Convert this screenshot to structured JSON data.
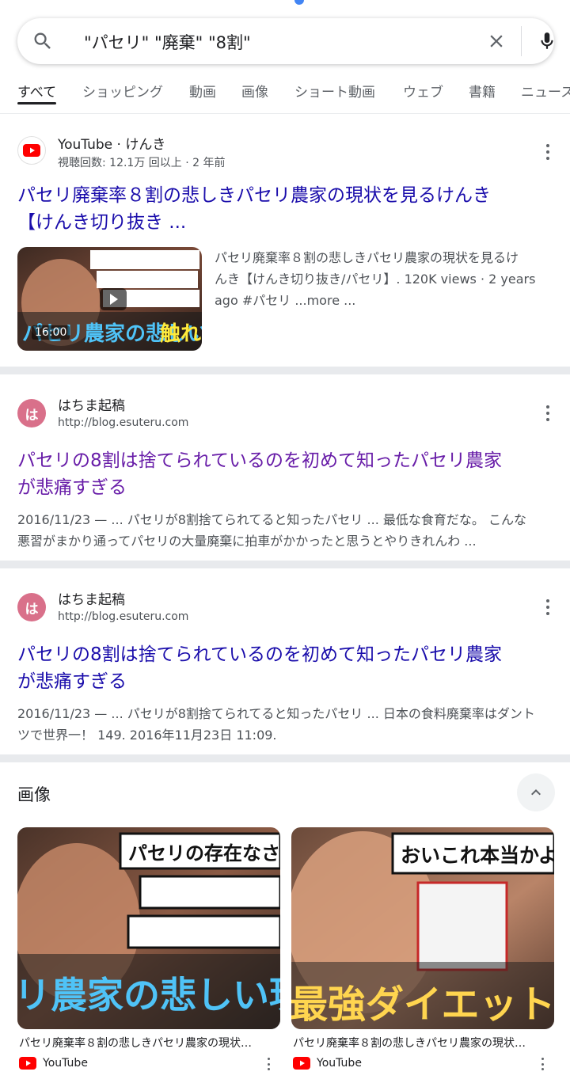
{
  "search": {
    "query": "\"パセリ\" \"廃棄\" \"8割\""
  },
  "tabs": [
    {
      "label": "すべて"
    },
    {
      "label": "ショッピング"
    },
    {
      "label": "動画"
    },
    {
      "label": "画像"
    },
    {
      "label": "ショート動画"
    },
    {
      "label": "ウェブ"
    },
    {
      "label": "書籍"
    },
    {
      "label": "ニュース"
    }
  ],
  "results": [
    {
      "site_name": "YouTube · けんき",
      "meta": "視聴回数: 12.1万 回以上 · 2 年前",
      "title_line1": "パセリ廃棄率８割の悲しきパセリ農家の現状を見るけんき",
      "title_line2": "【けんき切り抜き ...",
      "duration": "16:00",
      "thumb_text": "パセリの存在なさすぎるだろw",
      "snippet_line1": "パセリ廃棄率８割の悲しきパセリ農家の現状を見るけ",
      "snippet_line2": "んき【けんき切り抜き/パセリ】. 120K views · 2 years",
      "snippet_line3": "ago #パセリ ...more ..."
    },
    {
      "favicon_letter": "は",
      "site_name": "はちま起稿",
      "url": "http://blog.esuteru.com",
      "title_line1": "パセリの8割は捨てられているのを初めて知ったパセリ農家",
      "title_line2": "が悲痛すぎる",
      "snippet_line1": "2016/11/23 — ... パセリが8割捨てられてると知ったパセリ ... 最低な食育だな。 こんな",
      "snippet_line2": "悪習がまかり通ってパセリの大量廃棄に拍車がかかったと思うとやりきれんわ ..."
    },
    {
      "favicon_letter": "は",
      "site_name": "はちま起稿",
      "url": "http://blog.esuteru.com",
      "title_line1": "パセリの8割は捨てられているのを初めて知ったパセリ農家",
      "title_line2": "が悲痛すぎる",
      "snippet_line1": "2016/11/23 — ... パセリが8割捨てられてると知ったパセリ ... 日本の食料廃棄率はダント",
      "snippet_line2": "ツで世界一！ 149. 2016年11月23日 11:09."
    }
  ],
  "images": {
    "heading": "画像",
    "items": [
      {
        "caption": "パセリ廃棄率８割の悲しきパセリ農家の現状…",
        "source": "YouTube",
        "overlay_top": "パセリの存在なさすぎるだろ",
        "overlay_bottom": "リ農家の悲しい現状に触"
      },
      {
        "caption": "パセリ廃棄率８割の悲しきパセリ農家の現状…",
        "source": "YouTube",
        "overlay_top": "おいこれ本当かよw",
        "overlay_bottom": "最強ダイエット食"
      }
    ]
  }
}
